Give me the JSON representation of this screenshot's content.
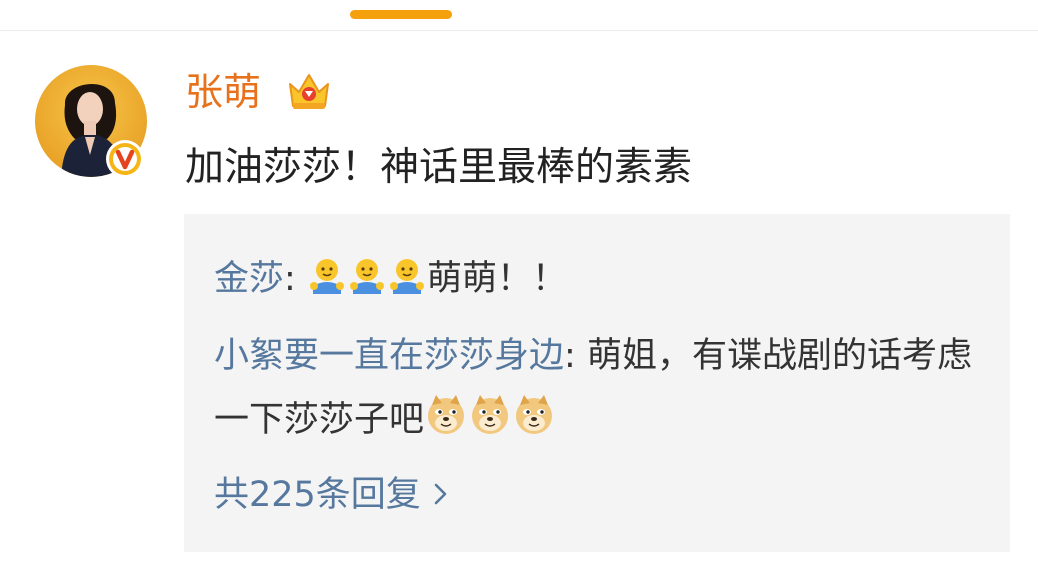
{
  "comment": {
    "username": "张萌",
    "text": "加油莎莎！神话里最棒的素素",
    "avatar_icon": "user-avatar-photo",
    "verified_icon": "verified-v-badge-icon",
    "vip_icon": "crown-icon"
  },
  "replies": [
    {
      "author": "金莎",
      "separator": ": ",
      "emoji_before": [
        "hug-emoji",
        "hug-emoji",
        "hug-emoji"
      ],
      "text": "萌萌！！"
    },
    {
      "author": "小絮要一直在莎莎身边",
      "separator": ": ",
      "text": "萌姐，有谍战剧的话考虑一下莎莎子吧",
      "emoji_after": [
        "doge-emoji",
        "doge-emoji",
        "doge-emoji"
      ]
    }
  ],
  "more_replies": {
    "label": "共225条回复",
    "icon": "chevron-right-icon"
  },
  "colors": {
    "tab_indicator": "#f5a00d",
    "username": "#e8721c",
    "link": "#56789e",
    "reply_box_bg": "#f4f4f4"
  }
}
